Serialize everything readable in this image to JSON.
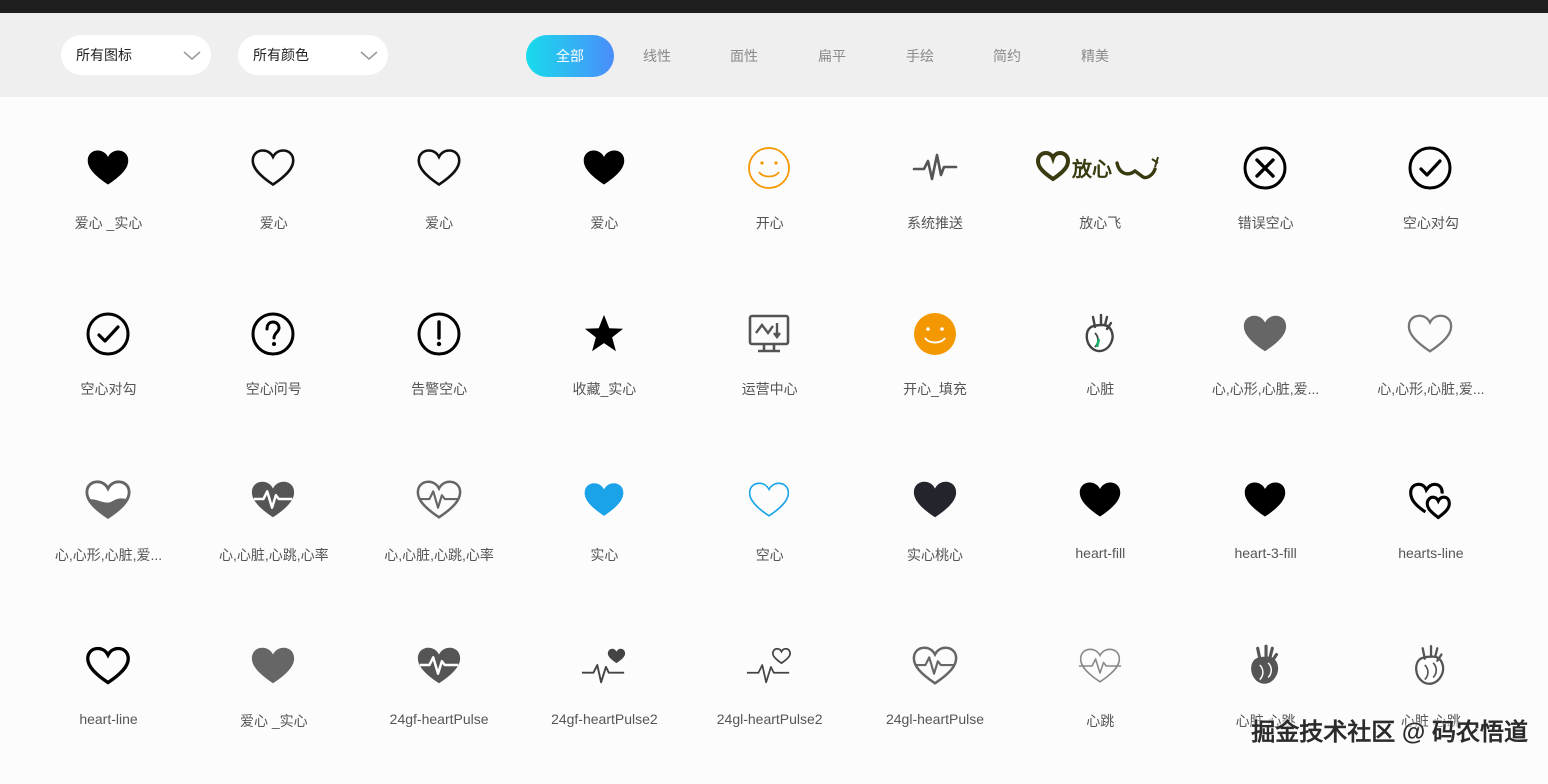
{
  "filters": {
    "icon_type": "所有图标",
    "color": "所有颜色"
  },
  "tabs": [
    "全部",
    "线性",
    "面性",
    "扁平",
    "手绘",
    "简约",
    "精美"
  ],
  "active_tab": "全部",
  "colors": {
    "accent_start": "#18dceb",
    "accent_end": "#4a8dfb",
    "orange": "#f39800",
    "blue": "#1aa3e8",
    "gray": "#666666"
  },
  "icons": [
    {
      "label": "爱心 _实心",
      "icon": "heart-filled-icon"
    },
    {
      "label": "爱心",
      "icon": "heart-outline-icon"
    },
    {
      "label": "爱心",
      "icon": "heart-outline-icon"
    },
    {
      "label": "爱心",
      "icon": "heart-filled-icon"
    },
    {
      "label": "开心",
      "icon": "smile-outline-icon"
    },
    {
      "label": "系统推送",
      "icon": "pulse-icon"
    },
    {
      "label": "放心飞",
      "icon": "fangxinfei-logo-icon"
    },
    {
      "label": "错误空心",
      "icon": "x-circle-icon"
    },
    {
      "label": "空心对勾",
      "icon": "check-circle-icon"
    },
    {
      "label": "空心对勾",
      "icon": "check-circle-icon"
    },
    {
      "label": "空心问号",
      "icon": "question-circle-icon"
    },
    {
      "label": "告警空心",
      "icon": "alert-circle-icon"
    },
    {
      "label": "收藏_实心",
      "icon": "star-filled-icon"
    },
    {
      "label": "运营中心",
      "icon": "monitor-chart-icon"
    },
    {
      "label": "开心_填充",
      "icon": "smile-filled-icon"
    },
    {
      "label": "心脏",
      "icon": "anatomical-heart-color-icon"
    },
    {
      "label": "心,心形,心脏,爱...",
      "icon": "heart-filled-gray-icon"
    },
    {
      "label": "心,心形,心脏,爱...",
      "icon": "heart-outline-gray-icon"
    },
    {
      "label": "心,心形,心脏,爱...",
      "icon": "heart-half-fill-icon"
    },
    {
      "label": "心,心脏,心跳,心率",
      "icon": "heart-pulse-filled-icon"
    },
    {
      "label": "心,心脏,心跳,心率",
      "icon": "heart-pulse-outline-icon"
    },
    {
      "label": "实心",
      "icon": "heart-filled-blue-icon"
    },
    {
      "label": "空心",
      "icon": "heart-outline-blue-icon"
    },
    {
      "label": "实心桃心",
      "icon": "heart-filled-dark-icon"
    },
    {
      "label": "heart-fill",
      "icon": "heart-filled-icon"
    },
    {
      "label": "heart-3-fill",
      "icon": "heart-filled-icon"
    },
    {
      "label": "hearts-line",
      "icon": "hearts-line-icon"
    },
    {
      "label": "heart-line",
      "icon": "heart-line-icon"
    },
    {
      "label": "爱心 _实心",
      "icon": "heart-filled-gray-icon"
    },
    {
      "label": "24gf-heartPulse",
      "icon": "heart-pulse-filled-icon"
    },
    {
      "label": "24gf-heartPulse2",
      "icon": "pulse-heart-filled-icon"
    },
    {
      "label": "24gl-heartPulse2",
      "icon": "pulse-heart-outline-icon"
    },
    {
      "label": "24gl-heartPulse",
      "icon": "heart-pulse-outline-icon"
    },
    {
      "label": "心跳",
      "icon": "heartbeat-line-icon"
    },
    {
      "label": "心脏 心跳",
      "icon": "anatomical-heart-filled-icon"
    },
    {
      "label": "心脏 心跳",
      "icon": "anatomical-heart-outline-icon"
    }
  ],
  "watermark": "掘金技术社区 @ 码农悟道"
}
